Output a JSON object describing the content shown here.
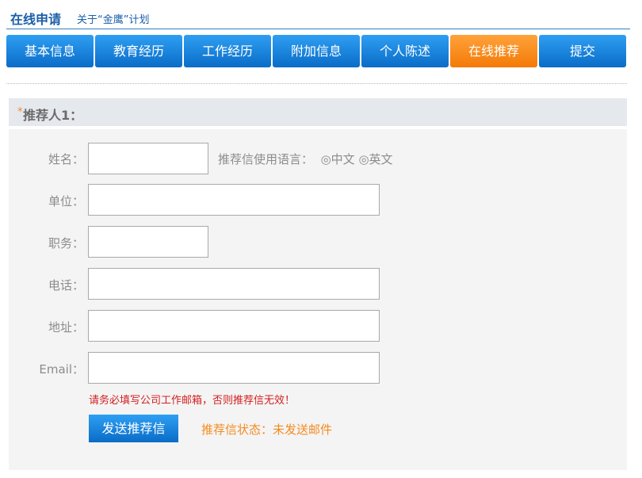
{
  "header": {
    "title": "在线申请",
    "about_link": "关于“金鹰”计划"
  },
  "tabs": [
    {
      "label": "基本信息",
      "active": false
    },
    {
      "label": "教育经历",
      "active": false
    },
    {
      "label": "工作经历",
      "active": false
    },
    {
      "label": "附加信息",
      "active": false
    },
    {
      "label": "个人陈述",
      "active": false
    },
    {
      "label": "在线推荐",
      "active": true
    },
    {
      "label": "提交",
      "active": false
    }
  ],
  "section": {
    "required_mark": "*",
    "title": "推荐人1："
  },
  "form": {
    "name_label": "姓名：",
    "name_value": "",
    "language_label": "推荐信使用语言：",
    "language_options": [
      "中文",
      "英文"
    ],
    "unit_label": "单位：",
    "unit_value": "",
    "position_label": "职务：",
    "position_value": "",
    "phone_label": "电话：",
    "phone_value": "",
    "address_label": "地址：",
    "address_value": "",
    "email_label": "Email：",
    "email_value": "",
    "email_note": "请务必填写公司工作邮箱，否则推荐信无效！",
    "send_button": "发送推荐信",
    "status_text": "推荐信状态：未发送邮件"
  },
  "colors": {
    "primary_blue": "#0a6cc7",
    "active_orange": "#f47a07",
    "warning_red": "#d41f1f",
    "status_orange": "#f58a1f"
  }
}
